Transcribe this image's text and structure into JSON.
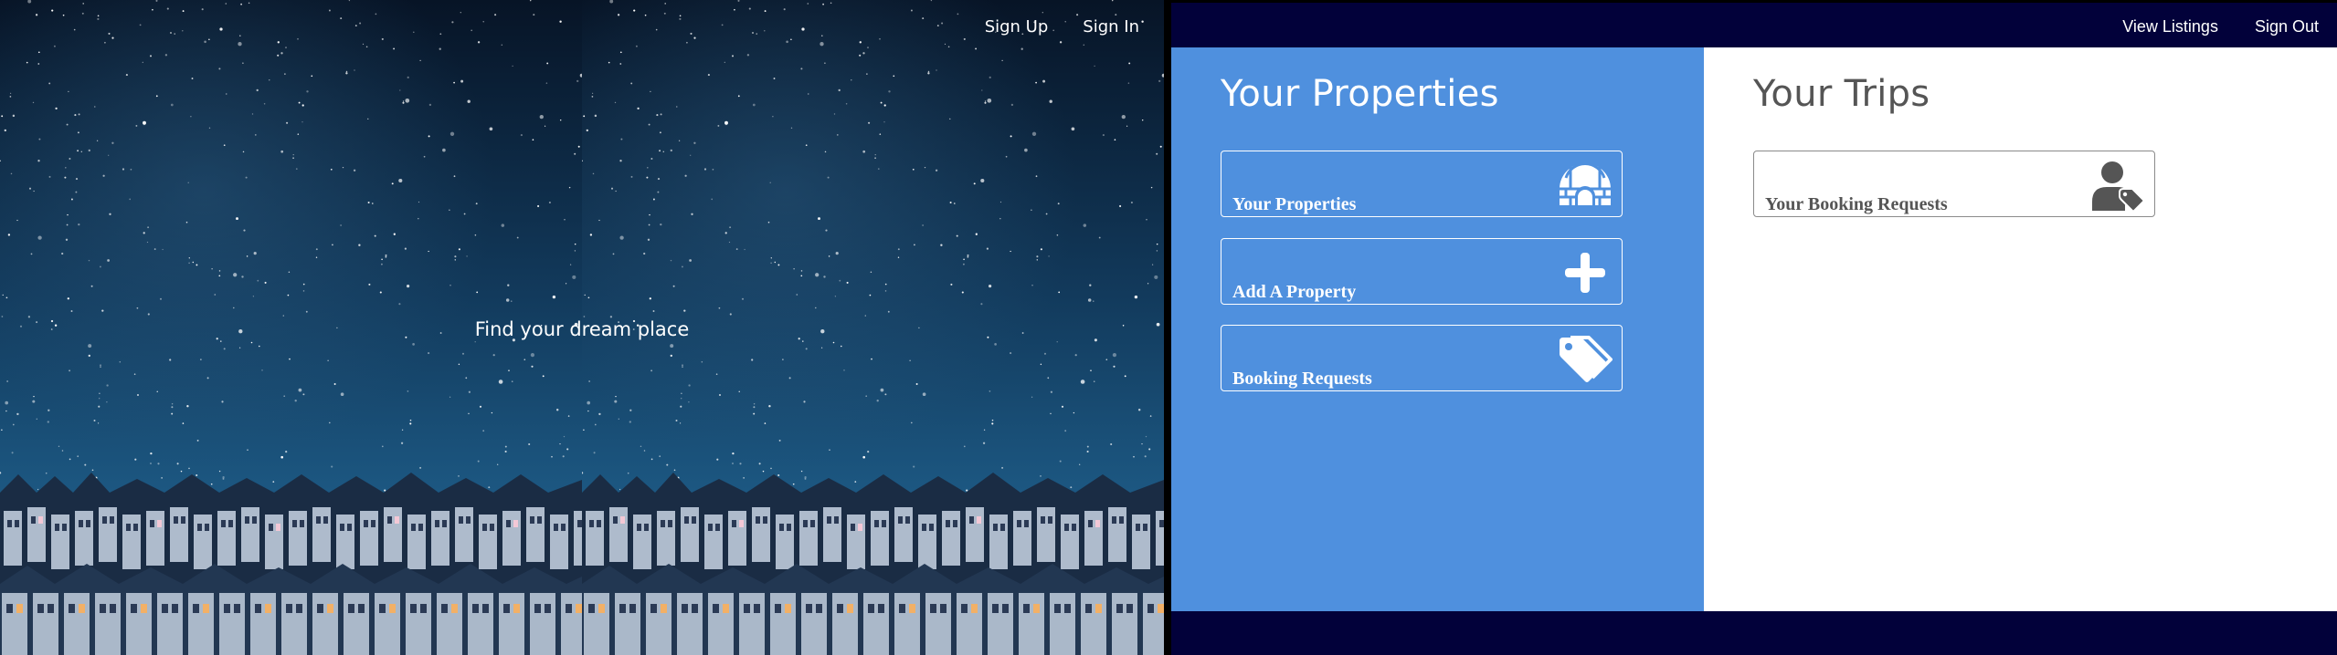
{
  "landing": {
    "nav": {
      "sign_up": "Sign Up",
      "sign_in": "Sign In"
    },
    "hero_text": "Find your dream place"
  },
  "dashboard": {
    "nav": {
      "view_listings": "View Listings",
      "sign_out": "Sign Out"
    },
    "properties": {
      "title": "Your Properties",
      "cards": [
        {
          "label": "Your Properties",
          "icon": "igloo-icon"
        },
        {
          "label": "Add A Property",
          "icon": "plus-icon"
        },
        {
          "label": "Booking Requests",
          "icon": "tags-icon"
        }
      ]
    },
    "trips": {
      "title": "Your Trips",
      "cards": [
        {
          "label": "Your Booking Requests",
          "icon": "user-tag-icon"
        }
      ]
    }
  },
  "colors": {
    "navbar": "#02013a",
    "properties_panel": "#4f90de",
    "trips_panel": "#ffffff",
    "trips_text": "#555555"
  }
}
